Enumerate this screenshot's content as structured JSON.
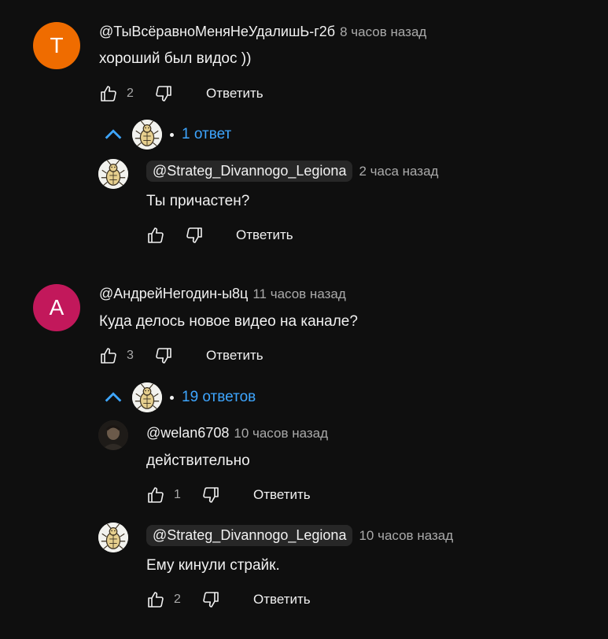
{
  "colors": {
    "background": "#0f0f0f",
    "link": "#3ea6ff",
    "avatar_t": "#ef6c00",
    "avatar_a": "#c2185b"
  },
  "comments": [
    {
      "avatar_letter": "T",
      "author": "@ТыВсёравноМеняНеУдалишЬ-г2б",
      "time": "8 часов назад",
      "text": "хороший был видос ))",
      "likes": "2",
      "reply_label": "Ответить",
      "replies_toggle": "1 ответ",
      "replies": [
        {
          "author": "@Strateg_Divannogo_Legiona",
          "time": "2 часа назад",
          "text": "Ты причастен?",
          "likes": "",
          "reply_label": "Ответить"
        }
      ]
    },
    {
      "avatar_letter": "А",
      "author": "@АндрейНегодин-ы8ц",
      "time": "11 часов назад",
      "text": "Куда делось новое видео на канале?",
      "likes": "3",
      "reply_label": "Ответить",
      "replies_toggle": "19 ответов",
      "replies": [
        {
          "author": "@welan6708",
          "time": "10 часов назад",
          "text": "действительно",
          "likes": "1",
          "reply_label": "Ответить"
        },
        {
          "author": "@Strateg_Divannogo_Legiona",
          "time": "10 часов назад",
          "text": "Ему кинули страйк.",
          "likes": "2",
          "reply_label": "Ответить"
        }
      ]
    }
  ],
  "icons": {
    "like": "thumb-up-icon",
    "dislike": "thumb-down-icon",
    "collapse": "chevron-up-icon"
  }
}
